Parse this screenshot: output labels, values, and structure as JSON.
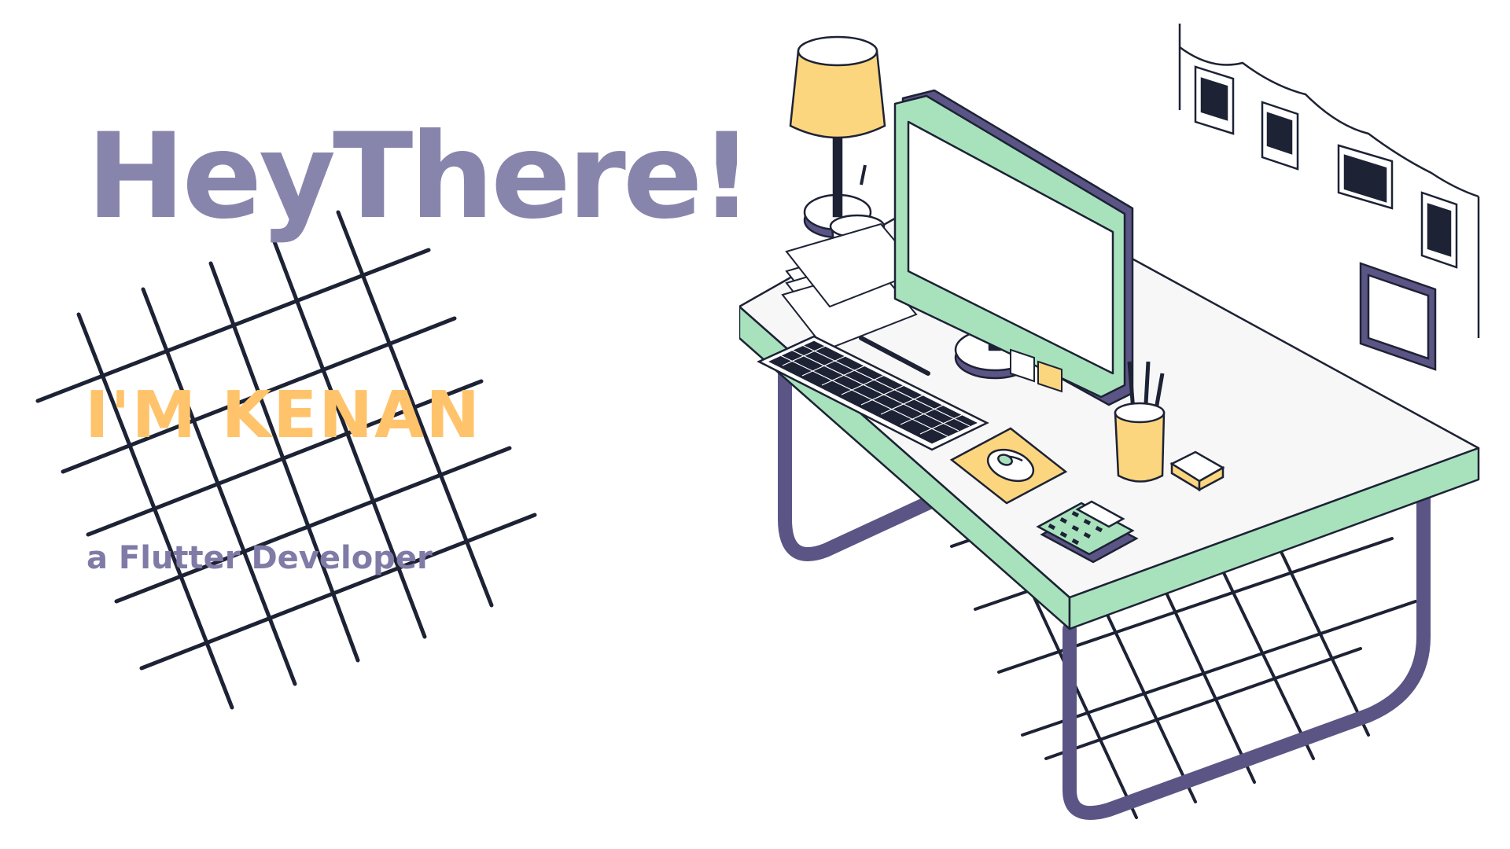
{
  "hero": {
    "greeting": "HeyThere!",
    "name": "I'M KENAN",
    "role": "a Flutter Developer"
  },
  "palette": {
    "greeting_color": "#8885ad",
    "name_color": "#ffc46b",
    "role_color": "#7f7ba6",
    "desk_top": "#f5f5f5",
    "desk_edge": "#a8e2bd",
    "desk_legs": "#5a5585",
    "monitor_frame": "#a8e2bd",
    "lamp_shade": "#fbd67f",
    "mousepad": "#fbd67f",
    "grid_lines": "#1d2235"
  },
  "illustration": {
    "icons": [
      "desk-lamp-icon",
      "monitor-icon",
      "keyboard-icon",
      "mouse-icon",
      "calculator-icon",
      "cup-icon",
      "pencil-holder-icon",
      "paper-stack-icon",
      "photo-frame-icon",
      "sticky-notes-icon"
    ]
  }
}
